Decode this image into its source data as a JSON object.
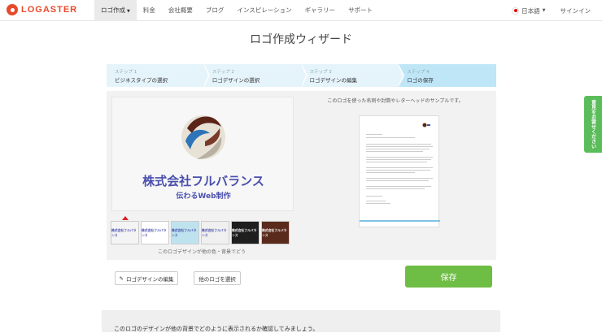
{
  "brand": {
    "name": "LOGASTER"
  },
  "nav": {
    "items": [
      "ロゴ作成",
      "料金",
      "会社概要",
      "ブログ",
      "インスピレーション",
      "ギャラリー",
      "サポート"
    ],
    "language": "日本語",
    "signin": "サインイン"
  },
  "page": {
    "title": "ロゴ作成ウィザード"
  },
  "steps": [
    {
      "num": "ステップ 1",
      "name": "ビジネスタイプの選択"
    },
    {
      "num": "ステップ 2",
      "name": "ロゴデザインの選択"
    },
    {
      "num": "ステップ 3",
      "name": "ロゴデザインの編集"
    },
    {
      "num": "ステップ 4",
      "name": "ロゴの保存"
    }
  ],
  "logo": {
    "company": "株式会社フルバランス",
    "tagline": "伝わるWeb制作"
  },
  "thumb_label": "株式会社フルバランス",
  "thumbs_caption": "このロゴデザインが他の色・背景でどう",
  "sample_caption": "このロゴを使った名刺や封筒やレターヘッドのサンプルです。",
  "buttons": {
    "edit": "ロゴデザインの編集",
    "choose_other": "他のロゴを選択",
    "save": "保存"
  },
  "bottom_text": "このロゴのデザインが他の背景でどのように表示されるか確認してみましょう。",
  "side_tab": "意見をお寄せください",
  "colors": {
    "accent": "#6ebd45",
    "brand": "#e8492b",
    "logo_text": "#4a4fae"
  }
}
